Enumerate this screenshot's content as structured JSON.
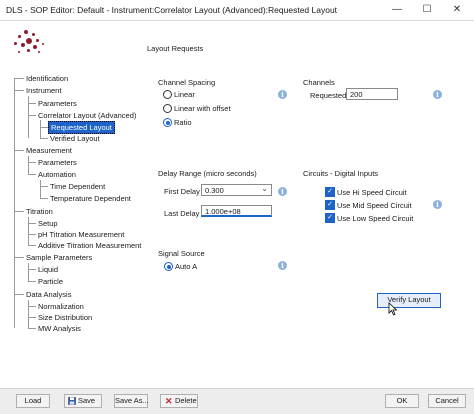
{
  "window": {
    "title": "DLS - SOP Editor: Default - Instrument:Correlator Layout (Advanced):Requested Layout",
    "minimize": "—",
    "maximize": "☐",
    "close": "✕"
  },
  "page": {
    "heading": "Layout Requests"
  },
  "tree": {
    "identification": "Identification",
    "instrument": "Instrument",
    "parameters": "Parameters",
    "correlator_layout": "Correlator Layout (Advanced)",
    "requested_layout": "Requested Layout",
    "verified_layout": "Verified Layout",
    "measurement": "Measurement",
    "m_parameters": "Parameters",
    "automation": "Automation",
    "time_dependent": "Time Dependent",
    "temperature_dependent": "Temperature Dependent",
    "titration": "Titration",
    "setup": "Setup",
    "ph_titration": "pH Titration Measurement",
    "additive_titration": "Additive Titration Measurement",
    "sample_parameters": "Sample Parameters",
    "liquid": "Liquid",
    "particle": "Particle",
    "data_analysis": "Data Analysis",
    "normalization": "Normalization",
    "size_distribution": "Size Distribution",
    "mw_analysis": "MW Analysis"
  },
  "channel_spacing": {
    "title": "Channel Spacing",
    "options": [
      "Linear",
      "Linear with offset",
      "Ratio"
    ],
    "selected": "Ratio"
  },
  "channels": {
    "title": "Channels",
    "requested_label": "Requested",
    "requested_value": "200"
  },
  "delay_range": {
    "title": "Delay Range (micro seconds)",
    "first_label": "First Delay",
    "first_value": "0.300",
    "last_label": "Last Delay",
    "last_value": "1.000e+08"
  },
  "circuits": {
    "title": "Circuits - Digital Inputs",
    "items": [
      "Use Hi Speed Circuit",
      "Use Mid Speed Circuit",
      "Use Low Speed Circuit"
    ],
    "checked": [
      true,
      true,
      true
    ]
  },
  "signal_source": {
    "title": "Signal Source",
    "option": "Auto A"
  },
  "buttons": {
    "verify_layout": "Verify Layout",
    "load": "Load",
    "save": "Save",
    "save_as": "Save As...",
    "delete": "Delete",
    "ok": "OK",
    "cancel": "Cancel"
  },
  "icons": {
    "info": "i",
    "checkmark": "✓",
    "dropdown": "⌄"
  },
  "colors": {
    "accent": "#1e63c8",
    "logo": "#8b1d2c",
    "info_icon": "#8cb0de"
  }
}
